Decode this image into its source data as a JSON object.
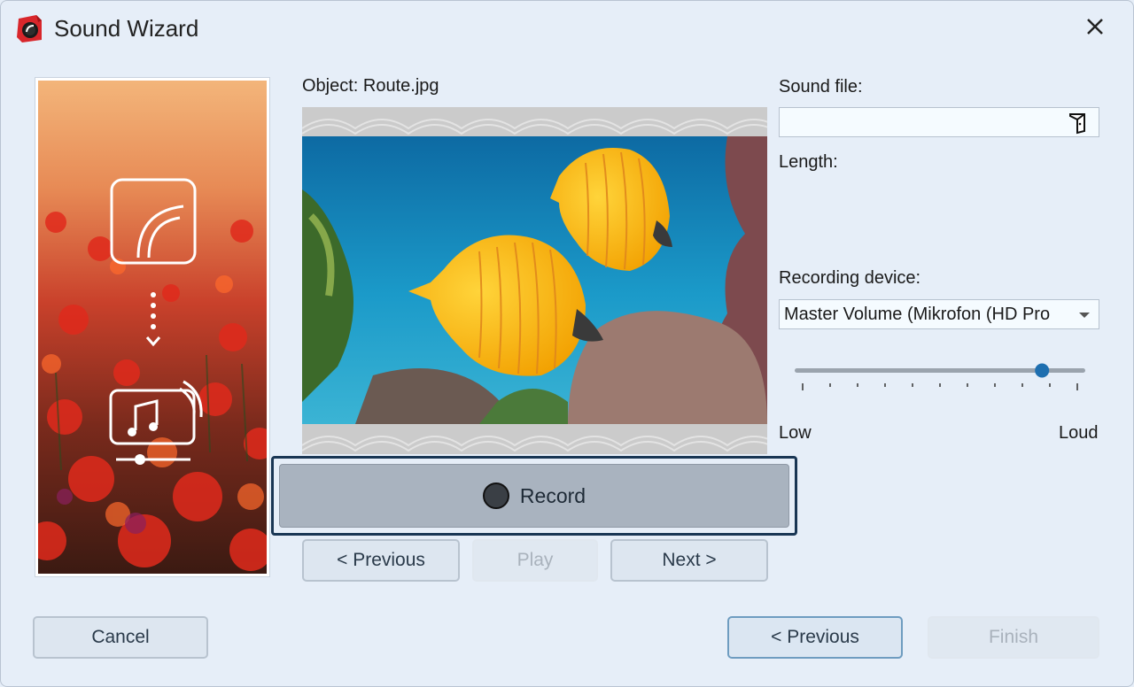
{
  "window": {
    "title": "Sound Wizard"
  },
  "preview": {
    "object_label": "Object: Route.jpg"
  },
  "record": {
    "label": "Record"
  },
  "nav": {
    "previous": "< Previous",
    "play": "Play",
    "next": "Next >"
  },
  "right": {
    "sound_file_label": "Sound file:",
    "sound_file_value": "",
    "length_label": "Length:",
    "recording_device_label": "Recording device:",
    "recording_device_value": "Master Volume (Mikrofon (HD Pro",
    "volume_level": 0.86,
    "low_label": "Low",
    "loud_label": "Loud"
  },
  "footer": {
    "cancel": "Cancel",
    "previous": "< Previous",
    "finish": "Finish"
  },
  "icons": [
    "app-icon",
    "close-icon",
    "folder-icon",
    "record-dot-icon",
    "camera-icon",
    "music-screen-icon"
  ],
  "colors": {
    "accent": "#1e6fb0",
    "record_frame": "#193654",
    "background": "#e6eef8"
  }
}
